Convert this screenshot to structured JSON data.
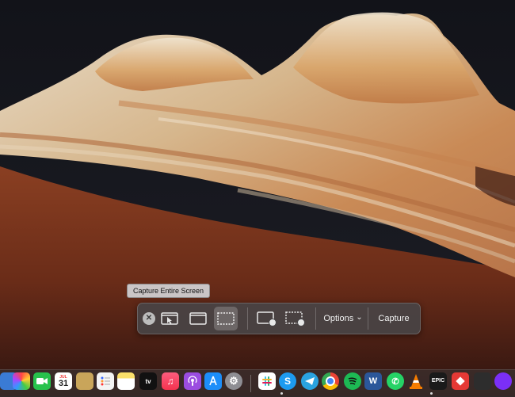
{
  "tooltip": {
    "text": "Capture Entire Screen"
  },
  "toolbar": {
    "close_icon": "✕",
    "options_label": "Options",
    "options_chevron": "⌄",
    "capture_label": "Capture",
    "selected_mode": "capture-entire-screen"
  },
  "dock": {
    "calendar_month": "JUL",
    "calendar_day": "31",
    "tv_label": "tv",
    "skype_letter": "S",
    "word_letter": "W",
    "epic_label": "EPIC"
  }
}
